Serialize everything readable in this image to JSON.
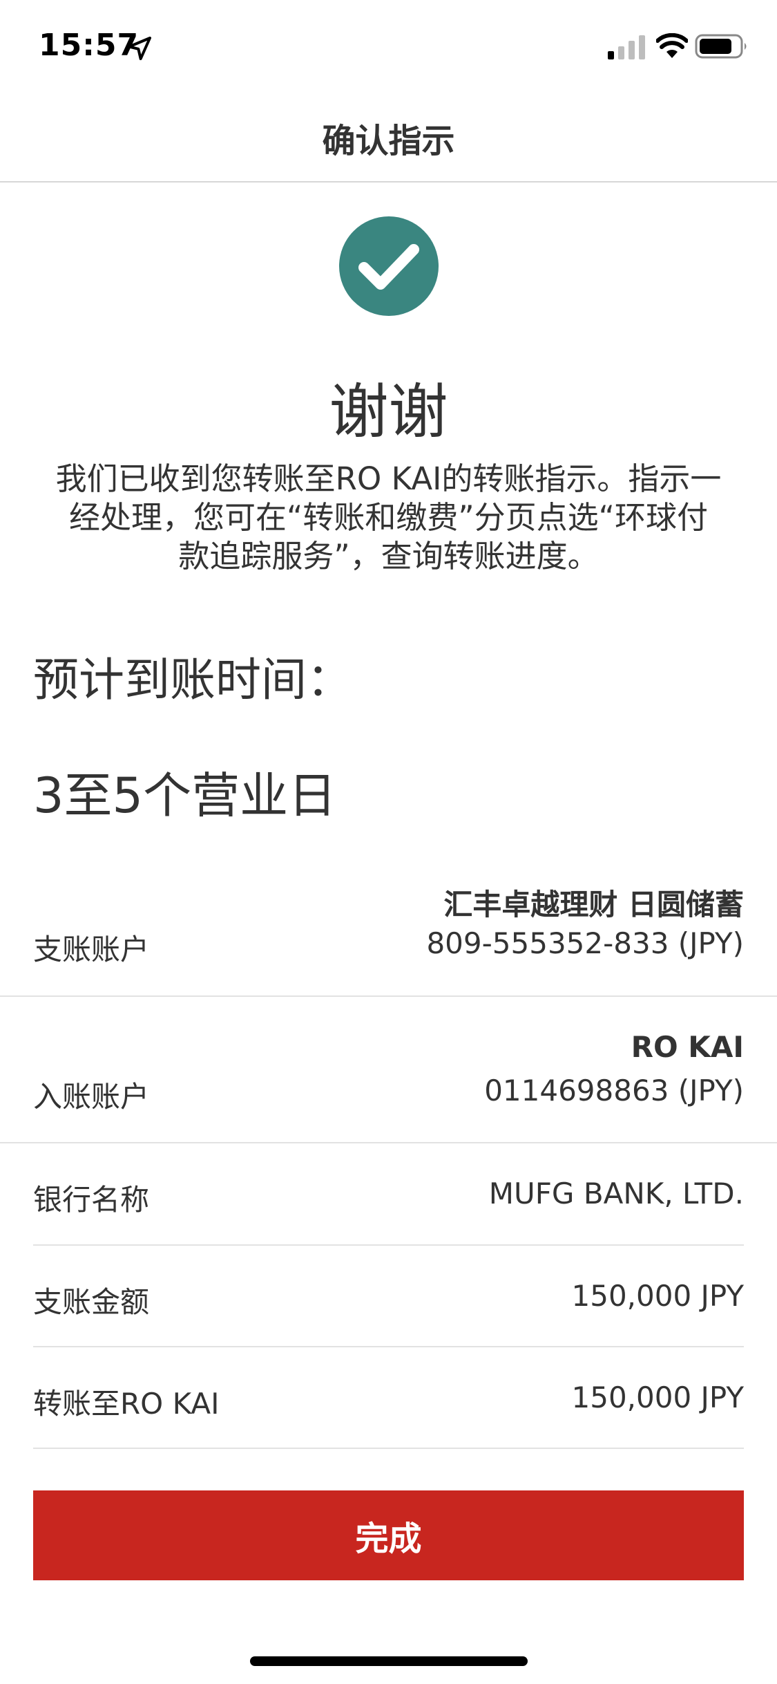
{
  "status_bar": {
    "time": "15:57"
  },
  "nav": {
    "title": "确认指示"
  },
  "success": {
    "title": "谢谢",
    "message": "我们已收到您转账至RO KAI的转账指示。指示一经处理，您可在“转账和缴费”分页点选“环球付款追踪服务”，查询转账进度。"
  },
  "eta": {
    "label": "预计到账时间：",
    "value": "3至5个营业日"
  },
  "details": {
    "from_account": {
      "label": "支账账户",
      "name": "汇丰卓越理财 日圆储蓄",
      "number": "809-555352-833 (JPY)"
    },
    "to_account": {
      "label": "入账账户",
      "name": "RO KAI",
      "number": "0114698863 (JPY)"
    },
    "bank_name": {
      "label": "银行名称",
      "value": "MUFG BANK, LTD."
    },
    "debit_amount": {
      "label": "支账金额",
      "value": "150,000 JPY"
    },
    "transfer_amount": {
      "label": "转账至RO KAI",
      "value": "150,000 JPY"
    }
  },
  "done_button": {
    "label": "完成"
  },
  "colors": {
    "accent_teal": "#3a8680",
    "button_red": "#c8261f",
    "text": "#333333"
  },
  "icons": [
    "location-arrow-icon",
    "signal-icon",
    "wifi-icon",
    "battery-icon",
    "checkmark-icon"
  ]
}
